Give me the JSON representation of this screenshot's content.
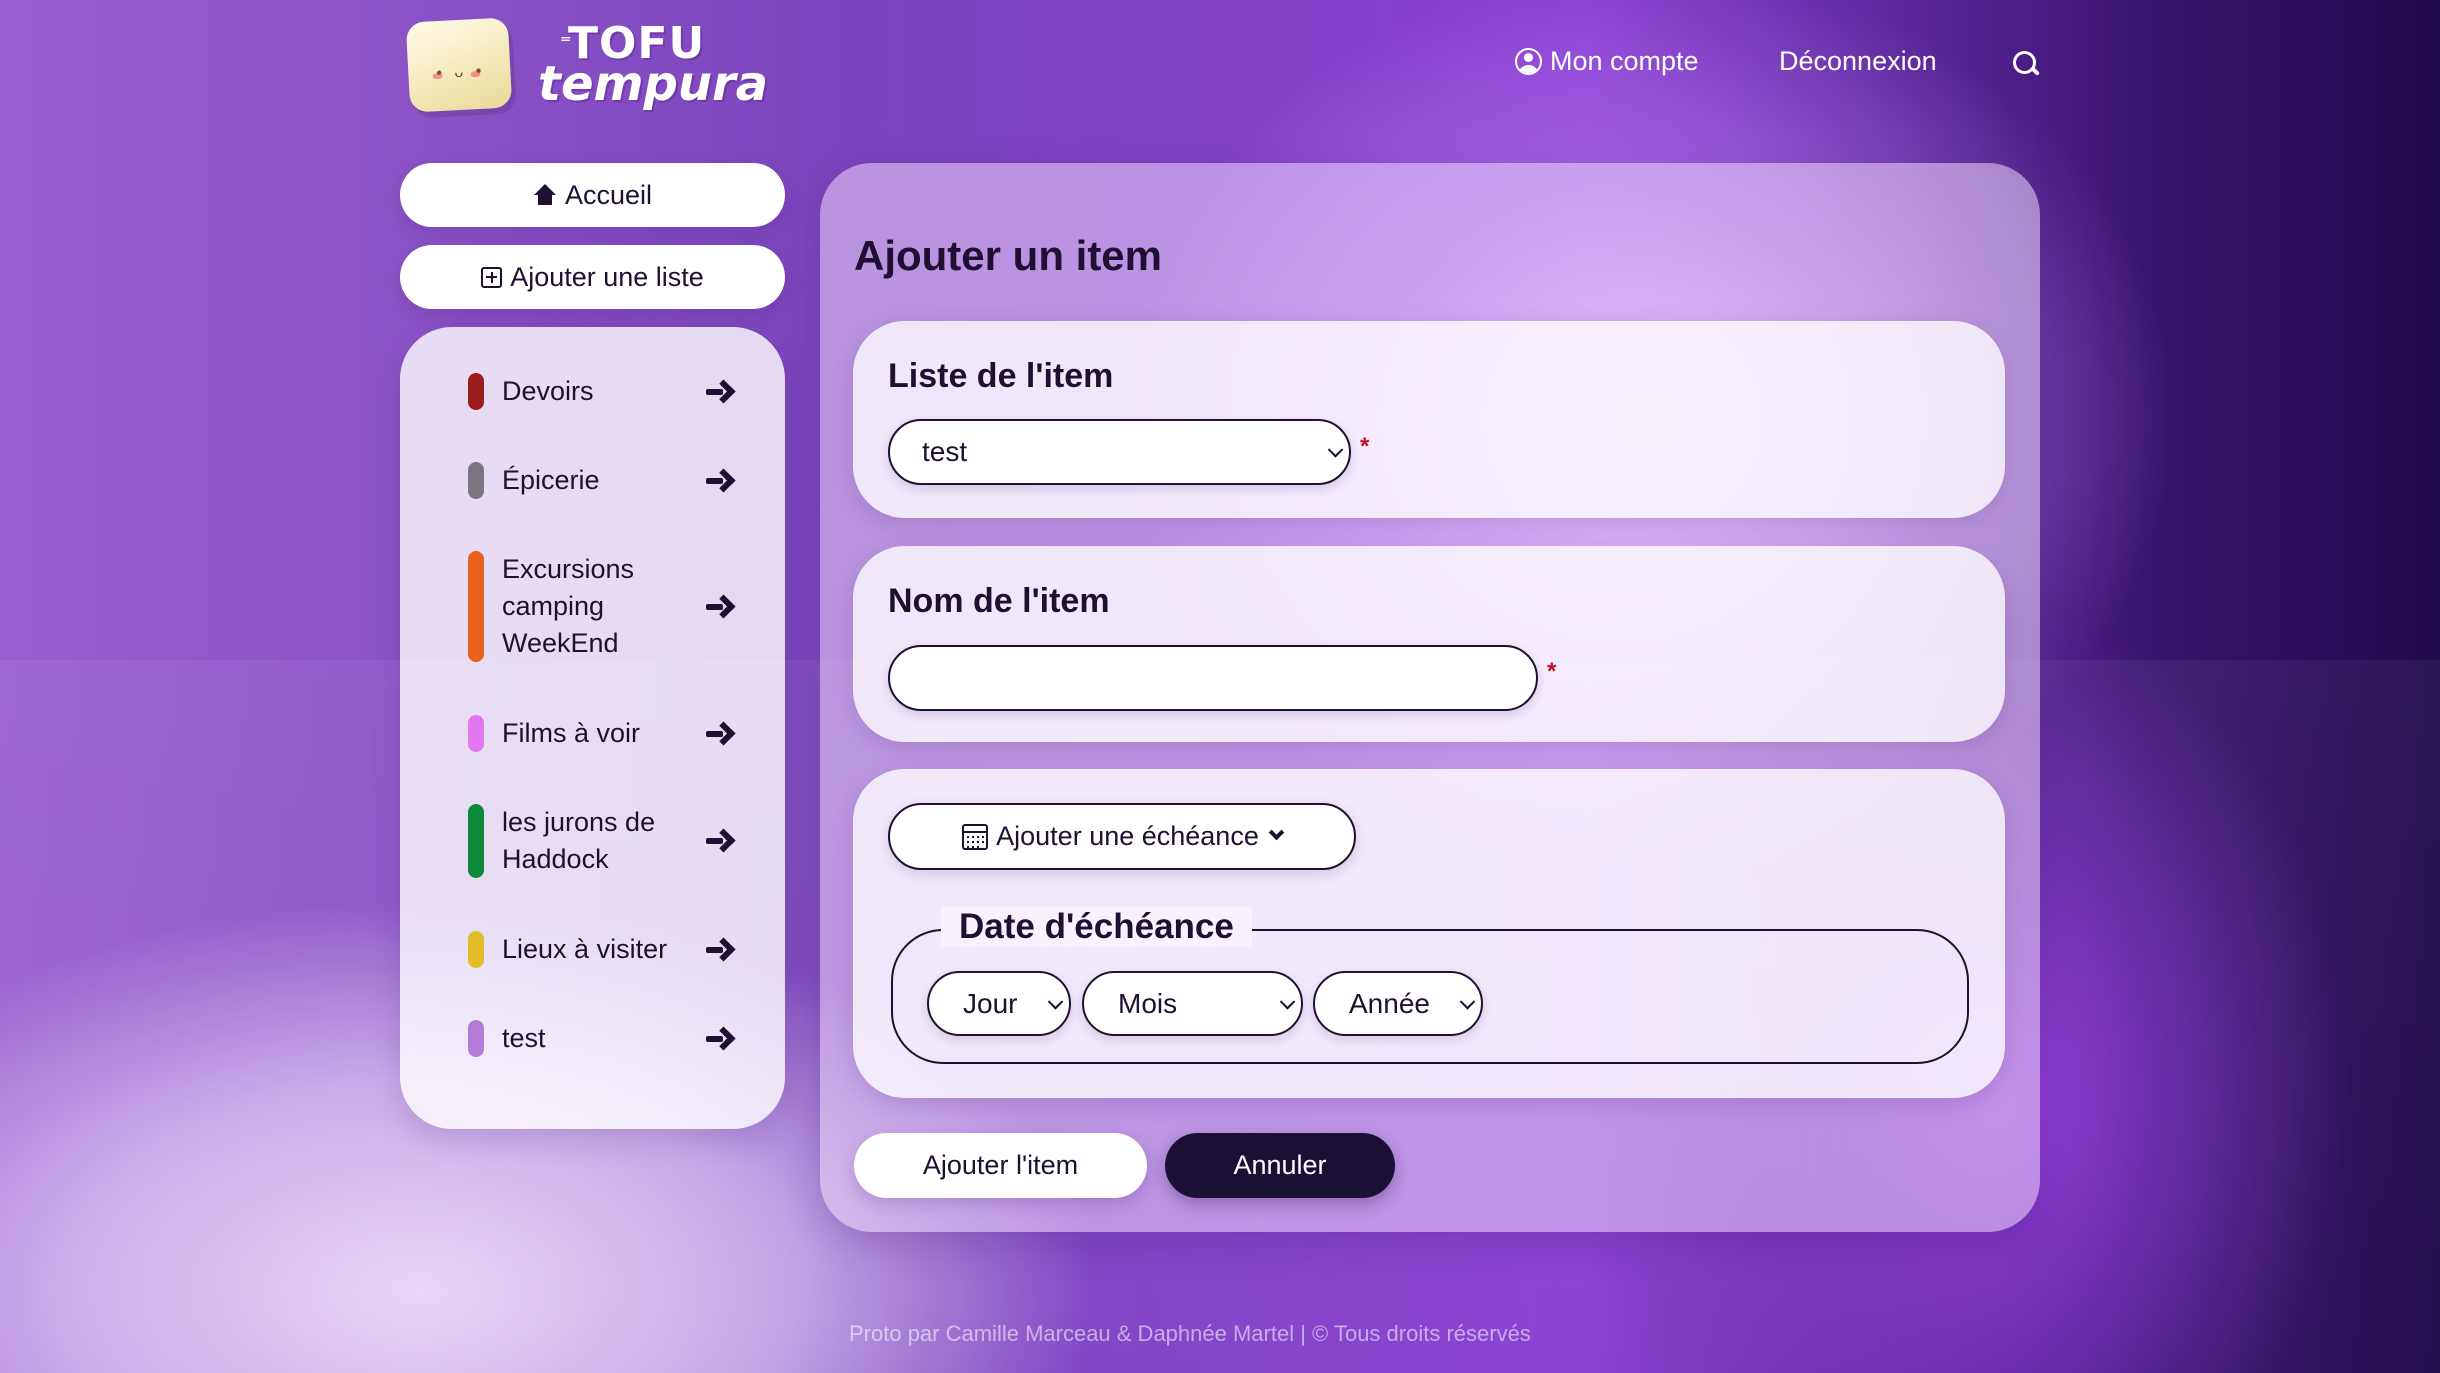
{
  "header": {
    "logo_word1": "TOFU",
    "logo_word2": "tempura",
    "account_label": "Mon compte",
    "logout_label": "Déconnexion",
    "icons": [
      "user-circle-icon",
      "search-icon"
    ]
  },
  "sidebar": {
    "home_label": "Accueil",
    "add_list_label": "Ajouter une liste",
    "lists": [
      {
        "label": "Devoirs",
        "color": "#9b1c1c"
      },
      {
        "label": "Épicerie",
        "color": "#7a7780"
      },
      {
        "label": "Excursions camping WeekEnd",
        "color": "#e8621b"
      },
      {
        "label": "Films à voir",
        "color": "#e277f2"
      },
      {
        "label": "les jurons de Haddock",
        "color": "#0e8a3a"
      },
      {
        "label": "Lieux à visiter",
        "color": "#e5bd2a"
      },
      {
        "label": "test",
        "color": "#b57bd9"
      }
    ]
  },
  "main": {
    "title": "Ajouter un item",
    "list_field": {
      "label": "Liste de l'item",
      "value": "test",
      "required_mark": "*"
    },
    "name_field": {
      "label": "Nom de l'item",
      "value": "",
      "required_mark": "*"
    },
    "due_toggle_label": "Ajouter une échéance",
    "due_date": {
      "legend": "Date d'échéance",
      "day": "Jour",
      "month": "Mois",
      "year": "Année"
    },
    "submit_label": "Ajouter l'item",
    "cancel_label": "Annuler"
  },
  "footer": {
    "text": "Proto par Camille Marceau & Daphnée Martel | © Tous droits réservés"
  },
  "colors": {
    "dark": "#1a1036",
    "required": "#c0102a"
  }
}
